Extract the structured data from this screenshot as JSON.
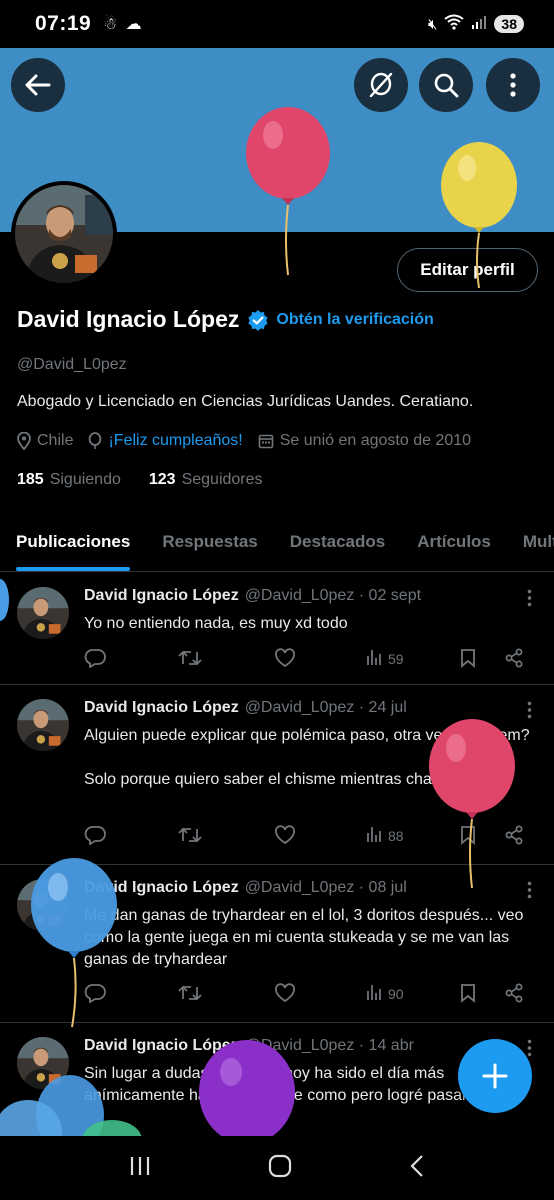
{
  "status_bar": {
    "time": "07:19",
    "battery": "38",
    "icons": [
      "notification-icon",
      "weather-icon",
      "mute-icon",
      "wifi-icon",
      "signal-icon"
    ]
  },
  "header": {
    "back_icon": "back-arrow-icon",
    "actions": [
      "hide-balloons-icon",
      "search-icon",
      "more-vertical-icon"
    ]
  },
  "profile": {
    "name": "David Ignacio López",
    "verify_cta": "Obtén la verificación",
    "handle": "@David_L0pez",
    "bio": "Abogado y Licenciado en Ciencias Jurídicas Uandes. Ceratiano.",
    "location": "Chile",
    "birthday": "¡Feliz cumpleaños!",
    "joined": "Se unió en agosto de 2010",
    "following_count": "185",
    "following_label": "Siguiendo",
    "followers_count": "123",
    "followers_label": "Seguidores",
    "edit_button": "Editar perfil"
  },
  "tabs": [
    "Publicaciones",
    "Respuestas",
    "Destacados",
    "Artículos",
    "Multimedia"
  ],
  "posts": [
    {
      "author": "David Ignacio López",
      "meta": "@David_L0pez · 02 sept",
      "text": "Yo no entiendo nada, es muy xd todo",
      "views": "59"
    },
    {
      "author": "David Ignacio López",
      "meta": "@David_L0pez · 24 jul",
      "text": "Alguien puede explicar que polémica paso, otra vez en el fem?\n\nSolo porque quiero saber el chisme mientras chambeo",
      "views": "88"
    },
    {
      "author": "David Ignacio López",
      "meta": "@David_L0pez · 08 jul",
      "text": "Me dan ganas de tryhardear en el lol, 3 doritos después... veo como la gente juega en mi cuenta stukeada y se me van las ganas de tryhardear",
      "views": "90"
    },
    {
      "author": "David Ignacio López",
      "meta": "@David_L0pez · 14 abr",
      "text": "Sin lugar a dudas, creo que hoy ha sido el día más anímicamente hablando, no se como pero logré pasar el día",
      "views": ""
    }
  ],
  "colors": {
    "banner": "#3e8dc4",
    "accent": "#1d9bf0",
    "balloon_red": "#e0456a",
    "balloon_yellow": "#e9d34b",
    "balloon_blue": "#4a9be3",
    "balloon_purple": "#8b2fc9"
  }
}
